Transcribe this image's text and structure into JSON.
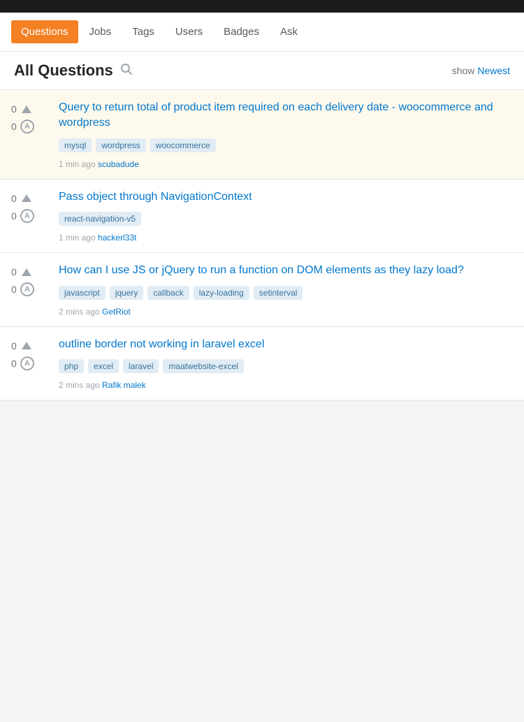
{
  "topbar": {},
  "nav": {
    "items": [
      {
        "label": "Questions",
        "active": true
      },
      {
        "label": "Jobs",
        "active": false
      },
      {
        "label": "Tags",
        "active": false
      },
      {
        "label": "Users",
        "active": false
      },
      {
        "label": "Badges",
        "active": false
      },
      {
        "label": "Ask",
        "active": false
      }
    ]
  },
  "header": {
    "title": "All Questions",
    "show_label": "show",
    "newest_label": "Newest"
  },
  "questions": [
    {
      "votes": "0",
      "answers": "0",
      "title": "Query to return total of product item required on each delivery date - woocommerce and wordpress",
      "tags": [
        "mysql",
        "wordpress",
        "woocommerce"
      ],
      "time": "1 min ago",
      "author": "scubadude",
      "highlighted": true
    },
    {
      "votes": "0",
      "answers": "0",
      "title": "Pass object through NavigationContext",
      "tags": [
        "react-navigation-v5"
      ],
      "time": "1 min ago",
      "author": "hackerl33t",
      "highlighted": false
    },
    {
      "votes": "0",
      "answers": "0",
      "title": "How can I use JS or jQuery to run a function on DOM elements as they lazy load?",
      "tags": [
        "javascript",
        "jquery",
        "callback",
        "lazy-loading",
        "setinterval"
      ],
      "time": "2 mins ago",
      "author": "GetRiot",
      "highlighted": false
    },
    {
      "votes": "0",
      "answers": "0",
      "title": "outline border not working in laravel excel",
      "tags": [
        "php",
        "excel",
        "laravel",
        "maatwebsite-excel"
      ],
      "time": "2 mins ago",
      "author": "Rafik malek",
      "highlighted": false
    }
  ]
}
